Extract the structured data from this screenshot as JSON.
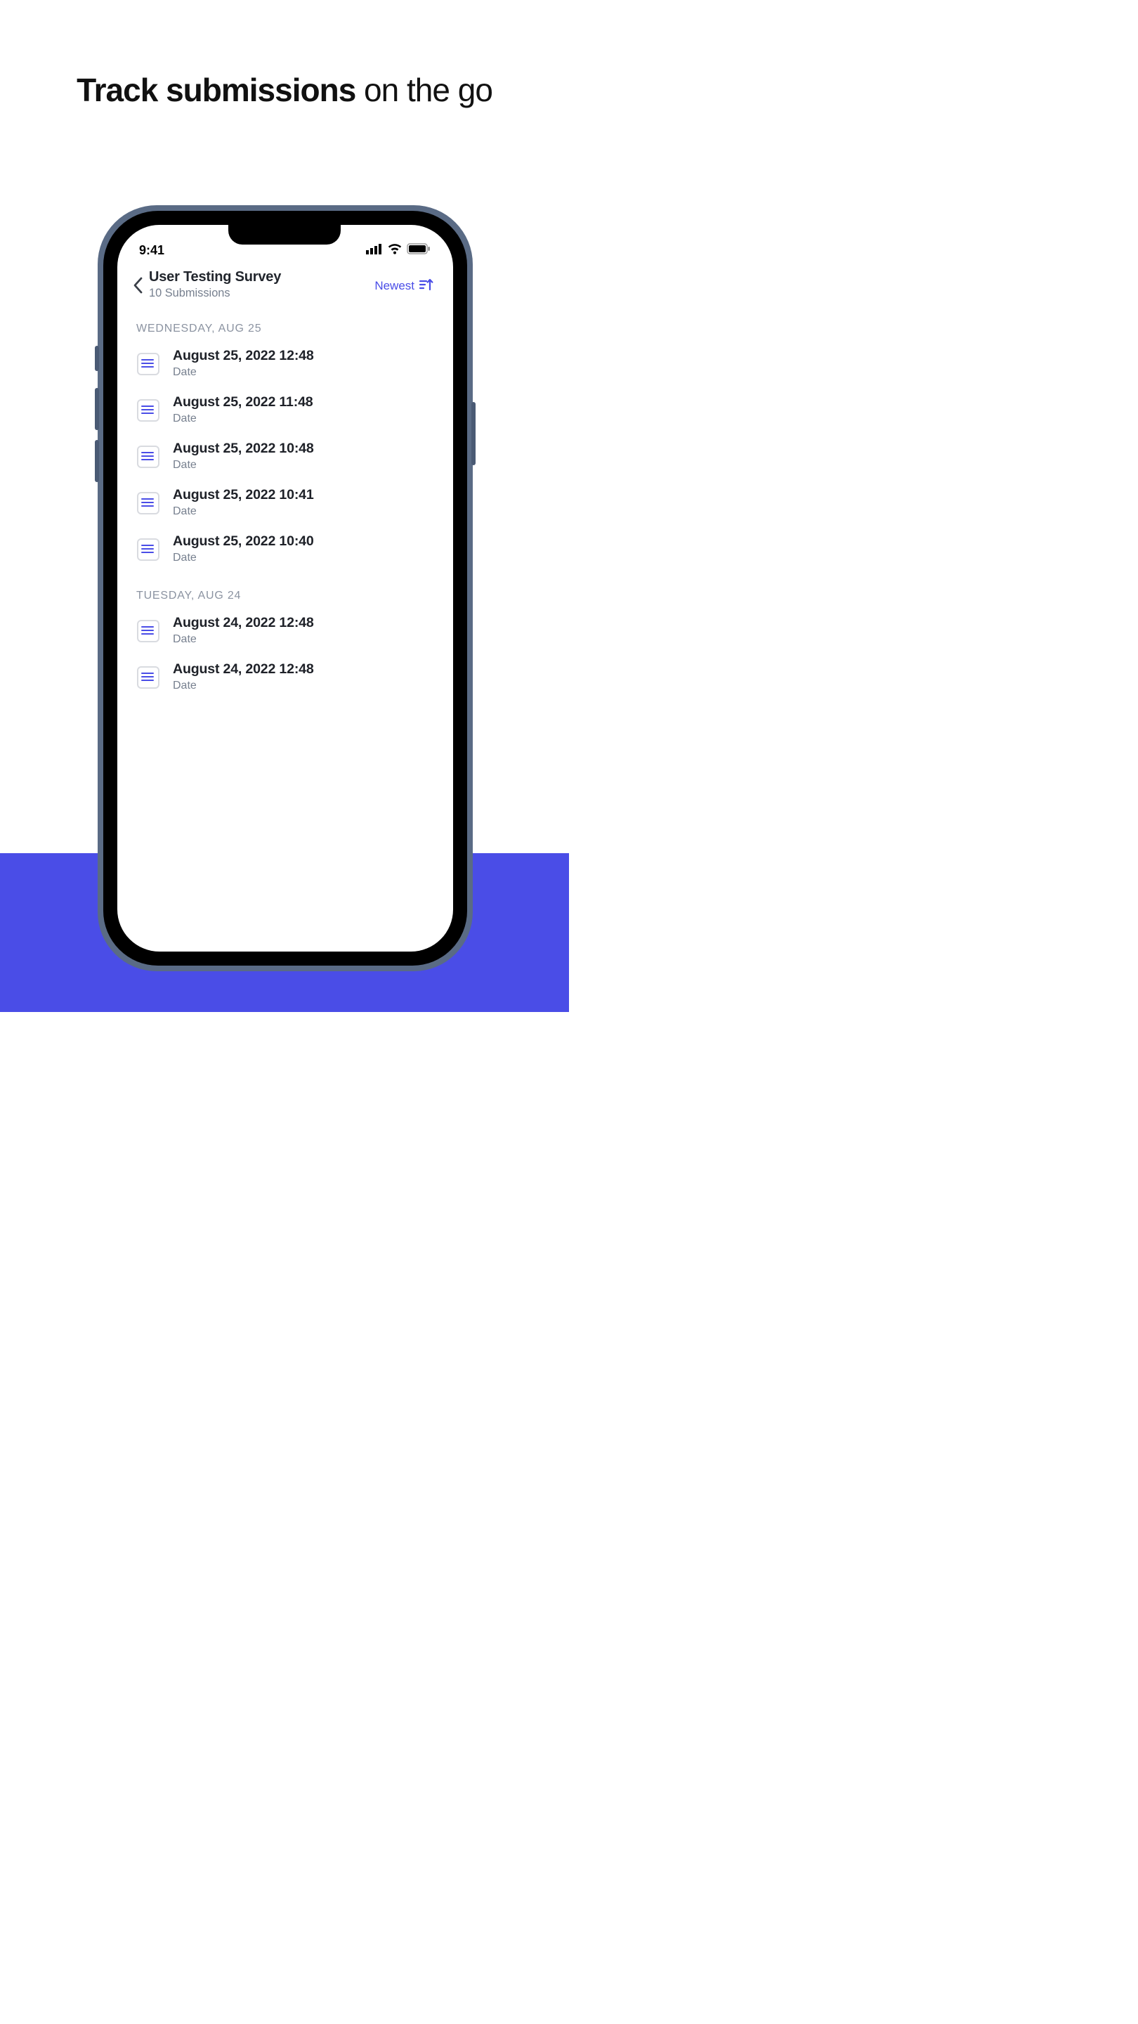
{
  "headline": {
    "bold": "Track submissions",
    "rest": " on the go"
  },
  "statusBar": {
    "time": "9:41"
  },
  "header": {
    "title": "User Testing Survey",
    "subtitle": "10 Submissions"
  },
  "sort": {
    "label": "Newest"
  },
  "sections": [
    {
      "header": "WEDNESDAY, AUG 25",
      "items": [
        {
          "title": "August 25, 2022 12:48",
          "sub": "Date"
        },
        {
          "title": "August 25, 2022 11:48",
          "sub": "Date"
        },
        {
          "title": "August 25, 2022 10:48",
          "sub": "Date"
        },
        {
          "title": "August 25, 2022 10:41",
          "sub": "Date"
        },
        {
          "title": "August 25, 2022 10:40",
          "sub": "Date"
        }
      ]
    },
    {
      "header": "TUESDAY, AUG 24",
      "items": [
        {
          "title": "August 24, 2022 12:48",
          "sub": "Date"
        },
        {
          "title": "August 24, 2022 12:48",
          "sub": "Date"
        }
      ]
    }
  ],
  "colors": {
    "accent": "#4a4de7"
  }
}
